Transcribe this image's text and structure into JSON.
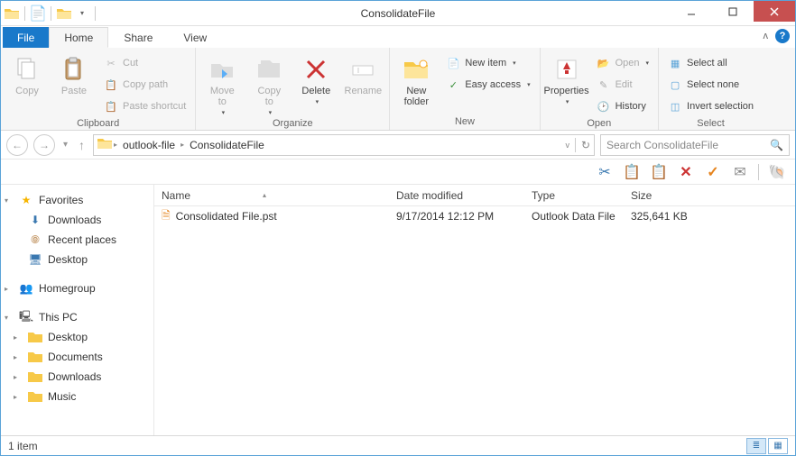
{
  "window": {
    "title": "ConsolidateFile"
  },
  "tabs": {
    "file": "File",
    "home": "Home",
    "share": "Share",
    "view": "View"
  },
  "ribbon": {
    "clipboard": {
      "label": "Clipboard",
      "copy": "Copy",
      "paste": "Paste",
      "cut": "Cut",
      "copy_path": "Copy path",
      "paste_shortcut": "Paste shortcut"
    },
    "organize": {
      "label": "Organize",
      "move_to": "Move\nto",
      "copy_to": "Copy\nto",
      "delete": "Delete",
      "rename": "Rename"
    },
    "new": {
      "label": "New",
      "new_folder": "New\nfolder",
      "new_item": "New item",
      "easy_access": "Easy access"
    },
    "open": {
      "label": "Open",
      "properties": "Properties",
      "open": "Open",
      "edit": "Edit",
      "history": "History"
    },
    "select": {
      "label": "Select",
      "select_all": "Select all",
      "select_none": "Select none",
      "invert": "Invert selection"
    }
  },
  "address": {
    "crumbs": [
      "outlook-file",
      "ConsolidateFile"
    ]
  },
  "search": {
    "placeholder": "Search ConsolidateFile"
  },
  "nav": {
    "favorites": {
      "label": "Favorites",
      "items": [
        "Downloads",
        "Recent places",
        "Desktop"
      ]
    },
    "homegroup": {
      "label": "Homegroup"
    },
    "this_pc": {
      "label": "This PC",
      "items": [
        "Desktop",
        "Documents",
        "Downloads",
        "Music"
      ]
    }
  },
  "columns": {
    "name": "Name",
    "date": "Date modified",
    "type": "Type",
    "size": "Size"
  },
  "files": [
    {
      "name": "Consolidated File.pst",
      "date": "9/17/2014 12:12 PM",
      "type": "Outlook Data File",
      "size": "325,641 KB"
    }
  ],
  "status": {
    "count": "1 item"
  }
}
